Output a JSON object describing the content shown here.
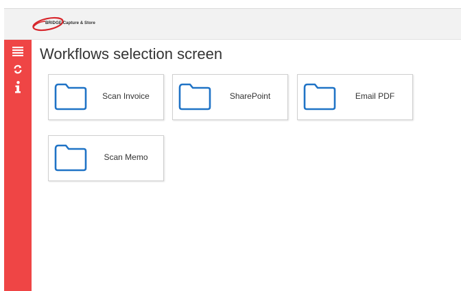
{
  "header": {
    "logo_text": "BRIDGE Capture & Store",
    "brand_color": "#d7242a"
  },
  "sidebar": {
    "color": "#ef4545",
    "icons": [
      {
        "name": "menu-icon"
      },
      {
        "name": "refresh-icon"
      },
      {
        "name": "info-icon"
      }
    ]
  },
  "main": {
    "title": "Workflows selection screen",
    "workflows": [
      {
        "label": "Scan Invoice",
        "icon": "folder-icon"
      },
      {
        "label": "SharePoint",
        "icon": "folder-icon"
      },
      {
        "label": "Email PDF",
        "icon": "folder-icon"
      },
      {
        "label": "Scan Memo",
        "icon": "folder-icon"
      }
    ],
    "folder_color": "#1f73c6"
  }
}
